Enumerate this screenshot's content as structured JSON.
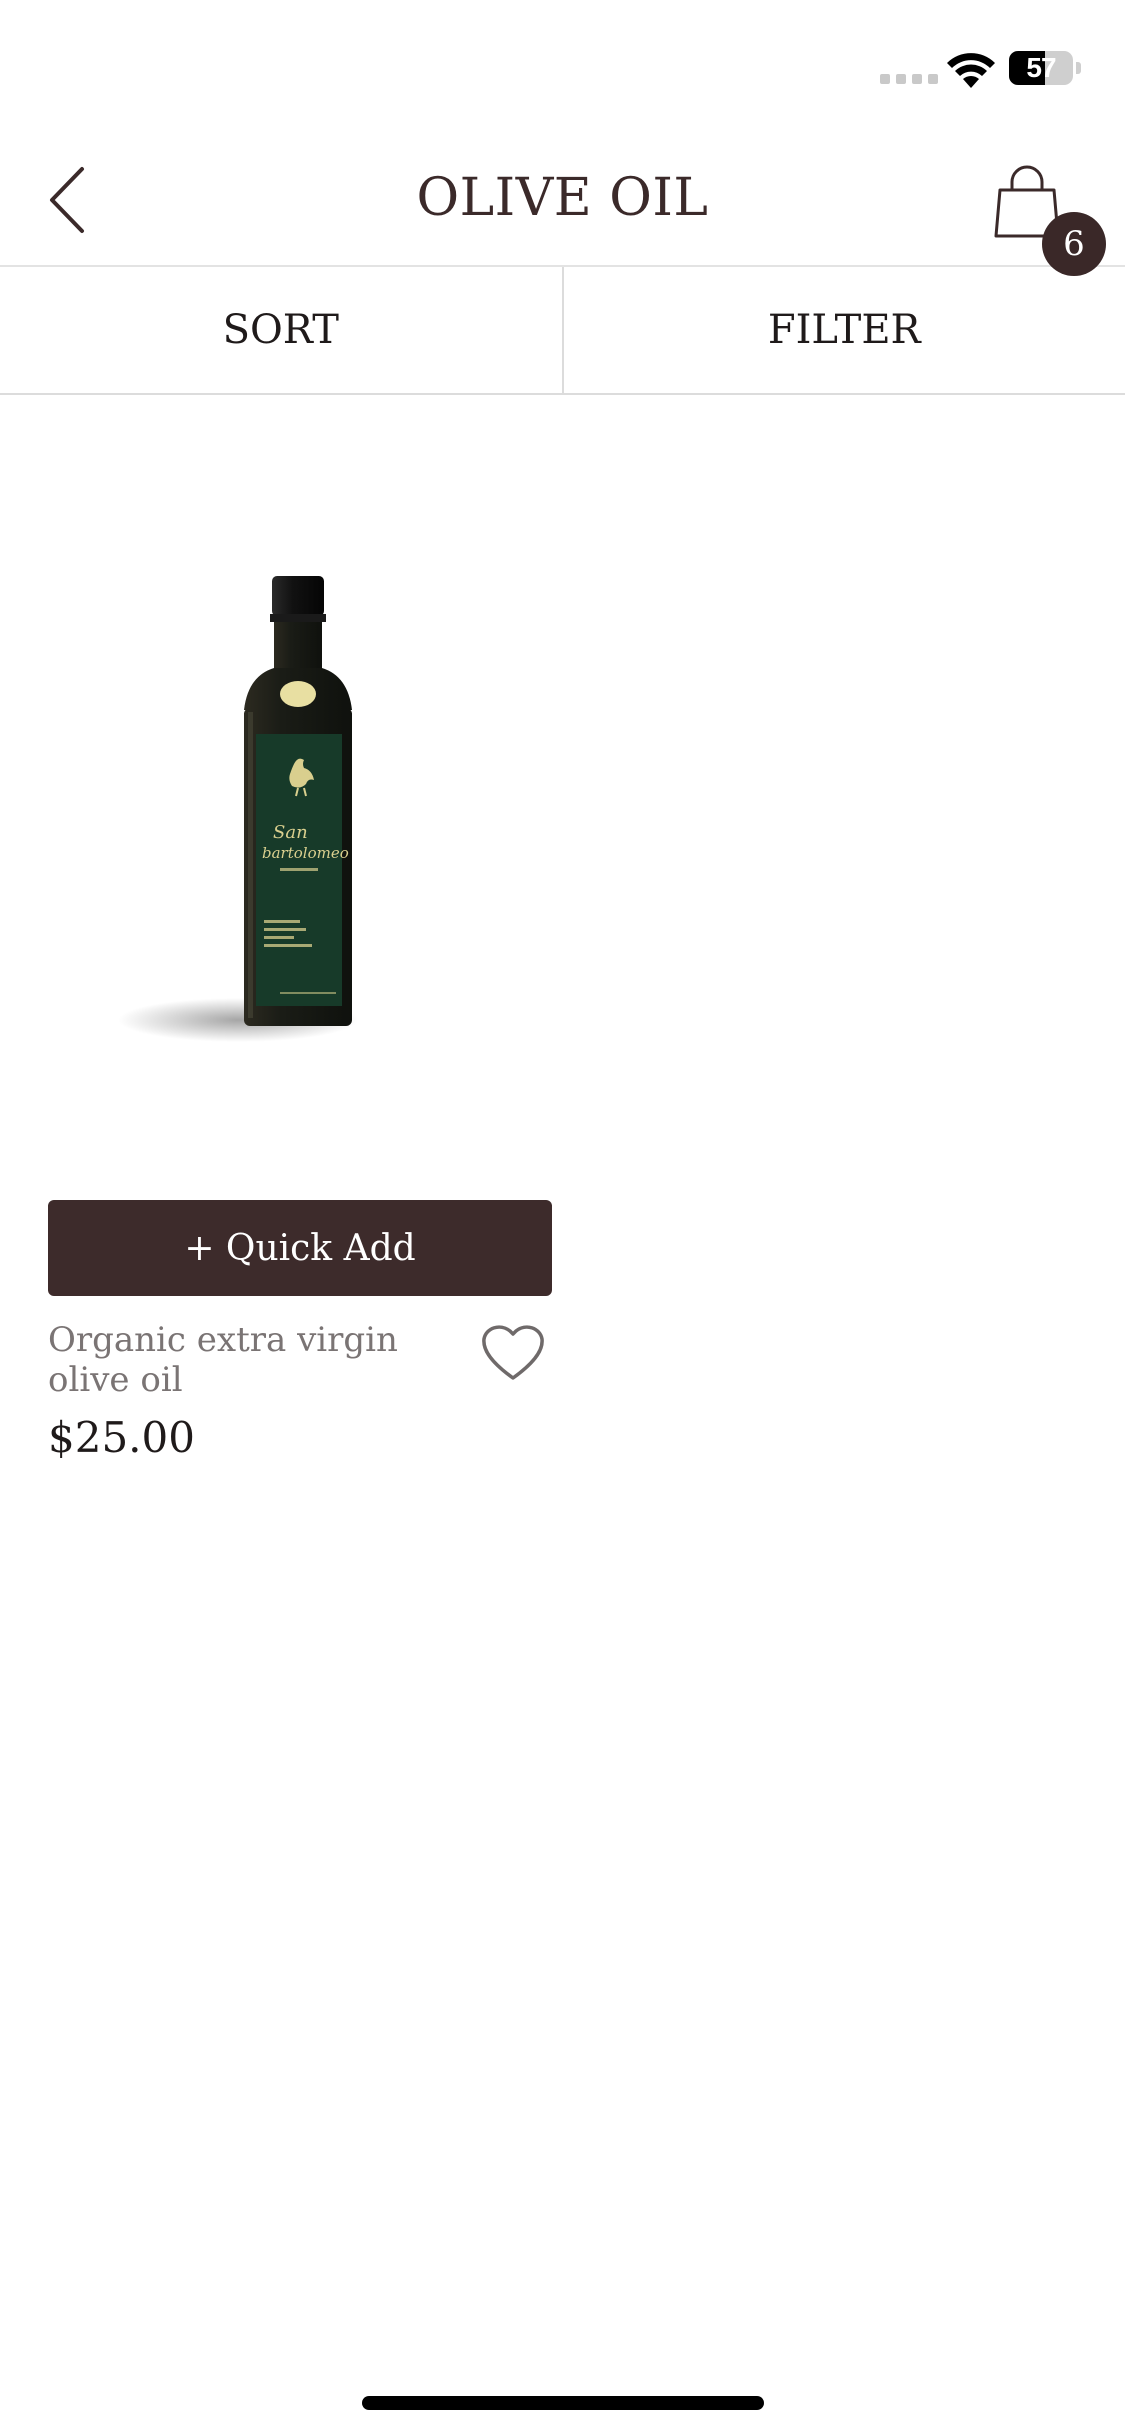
{
  "status_bar": {
    "battery_percent": "57",
    "battery_level": 0.57,
    "icons": [
      "signal-icon",
      "wifi-icon",
      "battery-icon"
    ]
  },
  "header": {
    "title": "OLIVE OIL",
    "back_icon": "chevron-left-icon",
    "cart_icon": "shopping-bag-icon",
    "cart_count": "6"
  },
  "controls": {
    "sort_label": "SORT",
    "filter_label": "FILTER"
  },
  "products": [
    {
      "quick_add_label": "+ Quick Add",
      "name": "Organic extra virgin olive oil",
      "price": "$25.00",
      "wishlist_icon": "heart-icon",
      "image": {
        "brand_line1": "San",
        "brand_line2": "bartolomeo",
        "colors": {
          "bottle": "#1d2a1f",
          "label": "#173a29",
          "text": "#d9cf8e"
        }
      }
    }
  ],
  "colors": {
    "accent": "#3d2b2b",
    "title": "#3b2a2a",
    "muted_text": "#7a7474"
  }
}
